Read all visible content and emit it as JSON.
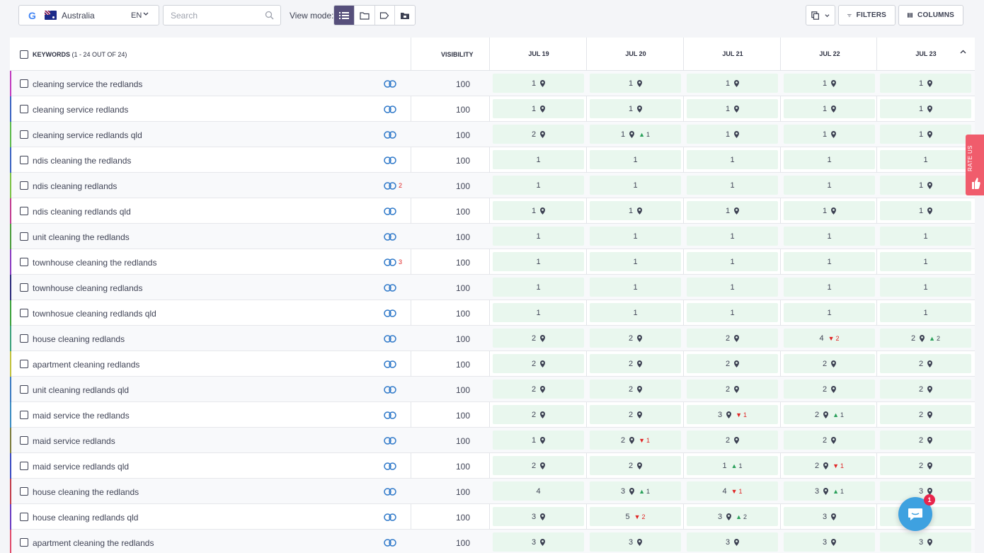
{
  "toolbar": {
    "country": "Australia",
    "language": "EN",
    "search_placeholder": "Search",
    "view_mode_label": "View mode:",
    "view_modes": [
      "list-icon",
      "folder-icon",
      "tag-icon",
      "folder-image-icon"
    ],
    "filters_label": "FILTERS",
    "columns_label": "COLUMNS"
  },
  "table": {
    "keywords_label": "KEYWORDS",
    "keywords_count": "(1 - 24 OUT OF 24)",
    "visibility_label": "VISIBILITY",
    "dates": [
      "JUL 19",
      "JUL 20",
      "JUL 21",
      "JUL 22",
      "JUL 23"
    ],
    "rows": [
      {
        "kw": "cleaning service the redlands",
        "color": "#c13abf",
        "links": "",
        "vis": "100",
        "cells": [
          {
            "v": "1",
            "pin": true
          },
          {
            "v": "1",
            "pin": true
          },
          {
            "v": "1",
            "pin": true
          },
          {
            "v": "1",
            "pin": true
          },
          {
            "v": "1",
            "pin": true
          }
        ]
      },
      {
        "kw": "cleaning service redlands",
        "color": "#3a63c1",
        "links": "",
        "vis": "100",
        "cells": [
          {
            "v": "1",
            "pin": true
          },
          {
            "v": "1",
            "pin": true
          },
          {
            "v": "1",
            "pin": true
          },
          {
            "v": "1",
            "pin": true
          },
          {
            "v": "1",
            "pin": true
          }
        ]
      },
      {
        "kw": "cleaning service redlands qld",
        "color": "#5bb84a",
        "links": "",
        "vis": "100",
        "cells": [
          {
            "v": "2",
            "pin": true
          },
          {
            "v": "1",
            "pin": true,
            "ch": "1",
            "dir": "up"
          },
          {
            "v": "1",
            "pin": true
          },
          {
            "v": "1",
            "pin": true
          },
          {
            "v": "1",
            "pin": true
          }
        ]
      },
      {
        "kw": "ndis cleaning the redlands",
        "color": "#3a63c1",
        "links": "",
        "vis": "100",
        "cells": [
          {
            "v": "1"
          },
          {
            "v": "1"
          },
          {
            "v": "1"
          },
          {
            "v": "1"
          },
          {
            "v": "1"
          }
        ]
      },
      {
        "kw": "ndis cleaning redlands",
        "color": "#7bc043",
        "links": "2",
        "vis": "100",
        "cells": [
          {
            "v": "1"
          },
          {
            "v": "1"
          },
          {
            "v": "1"
          },
          {
            "v": "1"
          },
          {
            "v": "1",
            "pin": true
          }
        ]
      },
      {
        "kw": "ndis cleaning redlands qld",
        "color": "#c13a8f",
        "links": "",
        "vis": "100",
        "cells": [
          {
            "v": "1",
            "pin": true
          },
          {
            "v": "1",
            "pin": true
          },
          {
            "v": "1",
            "pin": true
          },
          {
            "v": "1",
            "pin": true
          },
          {
            "v": "1",
            "pin": true
          }
        ]
      },
      {
        "kw": "unit cleaning the redlands",
        "color": "#4a9a3a",
        "links": "",
        "vis": "100",
        "cells": [
          {
            "v": "1"
          },
          {
            "v": "1"
          },
          {
            "v": "1"
          },
          {
            "v": "1"
          },
          {
            "v": "1"
          }
        ]
      },
      {
        "kw": "townhouse cleaning the redlands",
        "color": "#8a3ac1",
        "links": "3",
        "vis": "100",
        "cells": [
          {
            "v": "1"
          },
          {
            "v": "1"
          },
          {
            "v": "1"
          },
          {
            "v": "1"
          },
          {
            "v": "1"
          }
        ]
      },
      {
        "kw": "townhouse cleaning redlands",
        "color": "#2a2a7a",
        "links": "",
        "vis": "100",
        "cells": [
          {
            "v": "1"
          },
          {
            "v": "1"
          },
          {
            "v": "1"
          },
          {
            "v": "1"
          },
          {
            "v": "1"
          }
        ]
      },
      {
        "kw": "townhosue cleaning redlands qld",
        "color": "#3aa03a",
        "links": "",
        "vis": "100",
        "cells": [
          {
            "v": "1"
          },
          {
            "v": "1"
          },
          {
            "v": "1"
          },
          {
            "v": "1"
          },
          {
            "v": "1"
          }
        ]
      },
      {
        "kw": "house cleaning redlands",
        "color": "#3aa07a",
        "links": "",
        "vis": "100",
        "cells": [
          {
            "v": "2",
            "pin": true
          },
          {
            "v": "2",
            "pin": true
          },
          {
            "v": "2",
            "pin": true
          },
          {
            "v": "4",
            "ch": "2",
            "dir": "down"
          },
          {
            "v": "2",
            "pin": true,
            "ch": "2",
            "dir": "up"
          }
        ]
      },
      {
        "kw": "apartment cleaning redlands",
        "color": "#c1c13a",
        "links": "",
        "vis": "100",
        "cells": [
          {
            "v": "2",
            "pin": true
          },
          {
            "v": "2",
            "pin": true
          },
          {
            "v": "2",
            "pin": true
          },
          {
            "v": "2",
            "pin": true
          },
          {
            "v": "2",
            "pin": true
          }
        ]
      },
      {
        "kw": "unit cleaning redlands qld",
        "color": "#3a7ac1",
        "links": "",
        "vis": "100",
        "cells": [
          {
            "v": "2",
            "pin": true
          },
          {
            "v": "2",
            "pin": true
          },
          {
            "v": "2",
            "pin": true
          },
          {
            "v": "2",
            "pin": true
          },
          {
            "v": "2",
            "pin": true
          }
        ]
      },
      {
        "kw": "maid service the redlands",
        "color": "#3a8ac1",
        "links": "",
        "vis": "100",
        "cells": [
          {
            "v": "2",
            "pin": true
          },
          {
            "v": "2",
            "pin": true
          },
          {
            "v": "3",
            "pin": true,
            "ch": "1",
            "dir": "down"
          },
          {
            "v": "2",
            "pin": true,
            "ch": "1",
            "dir": "up"
          },
          {
            "v": "2",
            "pin": true
          }
        ]
      },
      {
        "kw": "maid service redlands",
        "color": "#7a7a3a",
        "links": "",
        "vis": "100",
        "cells": [
          {
            "v": "1",
            "pin": true
          },
          {
            "v": "2",
            "pin": true,
            "ch": "1",
            "dir": "down"
          },
          {
            "v": "2",
            "pin": true
          },
          {
            "v": "2",
            "pin": true
          },
          {
            "v": "2",
            "pin": true
          }
        ]
      },
      {
        "kw": "maid service redlands qld",
        "color": "#3a4ac1",
        "links": "",
        "vis": "100",
        "cells": [
          {
            "v": "2",
            "pin": true
          },
          {
            "v": "2",
            "pin": true
          },
          {
            "v": "1",
            "ch": "1",
            "dir": "up"
          },
          {
            "v": "2",
            "pin": true,
            "ch": "1",
            "dir": "down"
          },
          {
            "v": "2",
            "pin": true
          }
        ]
      },
      {
        "kw": "house cleaning the redlands",
        "color": "#c13a4a",
        "links": "",
        "vis": "100",
        "cells": [
          {
            "v": "4"
          },
          {
            "v": "3",
            "pin": true,
            "ch": "1",
            "dir": "up"
          },
          {
            "v": "4",
            "ch": "1",
            "dir": "down"
          },
          {
            "v": "3",
            "pin": true,
            "ch": "1",
            "dir": "up"
          },
          {
            "v": "3",
            "pin": true
          }
        ]
      },
      {
        "kw": "house cleaning redlands qld",
        "color": "#6a3ac1",
        "links": "",
        "vis": "100",
        "cells": [
          {
            "v": "3",
            "pin": true
          },
          {
            "v": "5",
            "ch": "2",
            "dir": "down"
          },
          {
            "v": "3",
            "pin": true,
            "ch": "2",
            "dir": "up"
          },
          {
            "v": "3",
            "pin": true
          },
          {
            "v": ""
          }
        ]
      },
      {
        "kw": "apartment cleaning the redlands",
        "color": "#e04a6a",
        "links": "",
        "vis": "100",
        "cells": [
          {
            "v": "3",
            "pin": true
          },
          {
            "v": "3",
            "pin": true
          },
          {
            "v": "3",
            "pin": true
          },
          {
            "v": "3",
            "pin": true
          },
          {
            "v": "3",
            "pin": true
          }
        ]
      }
    ]
  },
  "rate_us": "RATE US",
  "chat_badge": "1"
}
